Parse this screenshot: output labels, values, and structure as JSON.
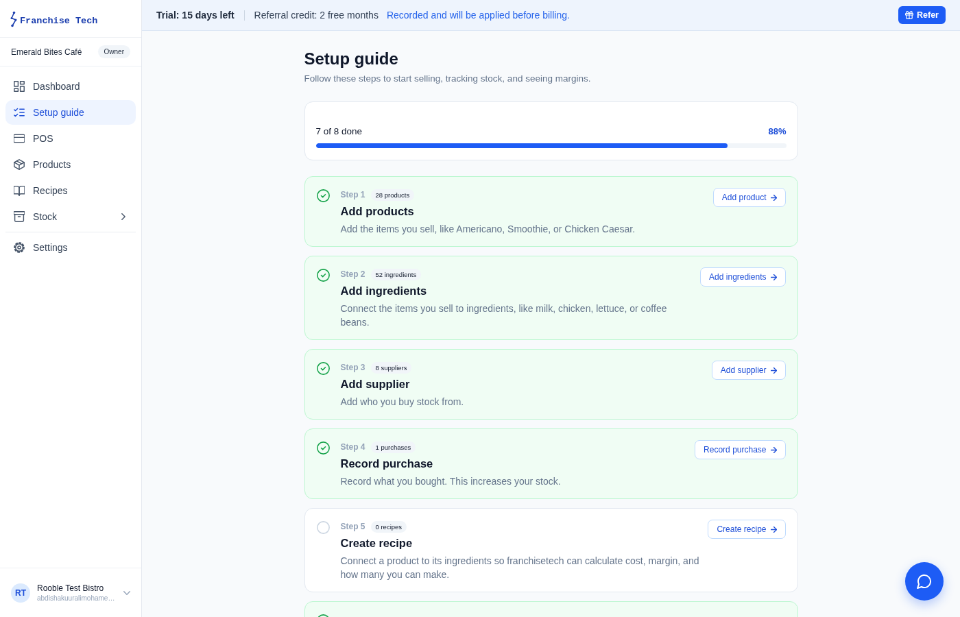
{
  "sidebar": {
    "logo": "Franchise Tech",
    "workspace": {
      "name": "Emerald Bites Café",
      "role": "Owner"
    },
    "nav_items": [
      {
        "label": "Dashboard",
        "kind": "link",
        "selected": false
      },
      {
        "label": "Setup guide",
        "kind": "link",
        "selected": true
      },
      {
        "label": "POS",
        "kind": "link",
        "selected": false
      },
      {
        "label": "Products",
        "kind": "link",
        "selected": false
      },
      {
        "label": "Recipes",
        "kind": "link",
        "selected": false
      },
      {
        "label": "Stock",
        "kind": "group",
        "expanded": false,
        "selected": false
      }
    ],
    "footer_items": [
      {
        "label": "Settings",
        "selected": false
      }
    ],
    "user": {
      "initials": "RT",
      "name": "Rooble Test Bistro",
      "email": "abdishakuuralimohame…"
    }
  },
  "banner": {
    "trial": "Trial: 15 days left",
    "referral": "Referral credit: 2 free months",
    "note": "Recorded and will be applied before billing.",
    "button": "Refer"
  },
  "page": {
    "title": "Setup guide",
    "subtitle": "Follow these steps to start selling, tracking stock, and seeing margins.",
    "progress": {
      "label": "7 of 8 done",
      "percent": "88%",
      "level": 0.875
    }
  },
  "steps": [
    {
      "step": "Step 1",
      "count": "28 products",
      "title": "Add products",
      "description": "Add the items you sell, like Americano, Smoothie, or Chicken Caesar.",
      "action": "Add product",
      "done": true
    },
    {
      "step": "Step 2",
      "count": "52 ingredients",
      "title": "Add ingredients",
      "description": "Connect the items you sell to ingredients, like milk, chicken, lettuce, or coffee beans.",
      "action": "Add ingredients",
      "done": true
    },
    {
      "step": "Step 3",
      "count": "8 suppliers",
      "title": "Add supplier",
      "description": "Add who you buy stock from.",
      "action": "Add supplier",
      "done": true
    },
    {
      "step": "Step 4",
      "count": "1 purchases",
      "title": "Record purchase",
      "description": "Record what you bought. This increases your stock.",
      "action": "Record purchase",
      "done": true
    },
    {
      "step": "Step 5",
      "count": "0 recipes",
      "title": "Create recipe",
      "description": "Connect a product to its ingredients so franchisetech can calculate cost, margin, and how many you can make.",
      "action": "Create recipe",
      "done": false
    },
    {
      "done": true
    }
  ]
}
